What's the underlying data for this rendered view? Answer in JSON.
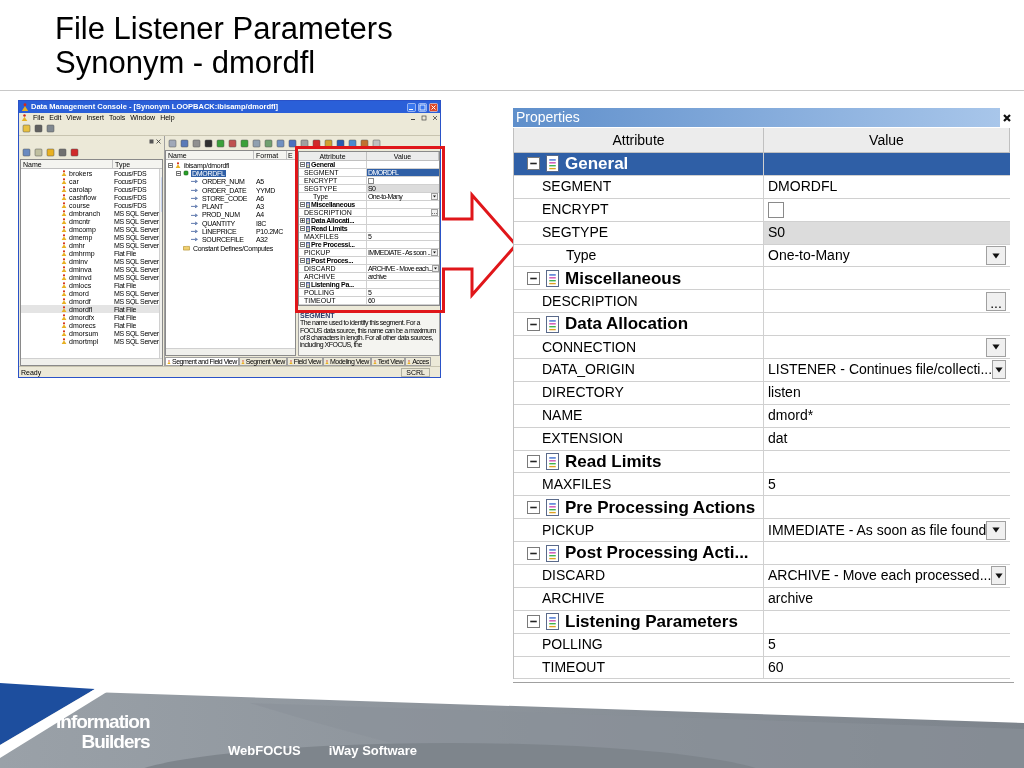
{
  "slide": {
    "title_lines": [
      "File Listener Parameters",
      "Synonym - dmordfl"
    ]
  },
  "console": {
    "window_title": "Data Management Console - [Synonym LOOPBACK:ibisamp/dmordfl]",
    "menu": [
      "File",
      "Edit",
      "View",
      "Insert",
      "Tools",
      "Window",
      "Help"
    ],
    "file_list": {
      "columns": [
        "Name",
        "Type"
      ],
      "rows": [
        {
          "name": "brokers",
          "type": "Focus/FDS",
          "selected": false
        },
        {
          "name": "car",
          "type": "Focus/FDS",
          "selected": false
        },
        {
          "name": "carolap",
          "type": "Focus/FDS",
          "selected": false
        },
        {
          "name": "cashflow",
          "type": "Focus/FDS",
          "selected": false
        },
        {
          "name": "course",
          "type": "Focus/FDS",
          "selected": false
        },
        {
          "name": "dmbranch",
          "type": "MS SQL Server",
          "selected": false
        },
        {
          "name": "dmcntr",
          "type": "MS SQL Server",
          "selected": false
        },
        {
          "name": "dmcomp",
          "type": "MS SQL Server",
          "selected": false
        },
        {
          "name": "dmemp",
          "type": "MS SQL Server",
          "selected": false
        },
        {
          "name": "dmhr",
          "type": "MS SQL Server",
          "selected": false
        },
        {
          "name": "dmhrmp",
          "type": "Flat File",
          "selected": false
        },
        {
          "name": "dminv",
          "type": "MS SQL Server",
          "selected": false
        },
        {
          "name": "dminva",
          "type": "MS SQL Server",
          "selected": false
        },
        {
          "name": "dminvd",
          "type": "MS SQL Server",
          "selected": false
        },
        {
          "name": "dmlocs",
          "type": "Flat File",
          "selected": false
        },
        {
          "name": "dmord",
          "type": "MS SQL Server",
          "selected": false
        },
        {
          "name": "dmordf",
          "type": "MS SQL Server",
          "selected": false
        },
        {
          "name": "dmordfl",
          "type": "Flat File",
          "selected": true
        },
        {
          "name": "dmordfx",
          "type": "Flat File",
          "selected": false
        },
        {
          "name": "dmorecs",
          "type": "Flat File",
          "selected": false
        },
        {
          "name": "dmorsum",
          "type": "MS SQL Server",
          "selected": false
        },
        {
          "name": "dmortmpl",
          "type": "MS SQL Server",
          "selected": false
        }
      ]
    },
    "tree": {
      "columns": [
        "Name",
        "Format",
        "E"
      ],
      "nodes": [
        {
          "kind": "synonym",
          "label": "ibisamp/dmordfl",
          "expanded": true,
          "selected": false,
          "children": [
            {
              "kind": "segment",
              "label": "DMORDFL",
              "expanded": true,
              "selected": true,
              "children": [
                {
                  "kind": "field",
                  "label": "ORDER_NUM",
                  "format": "A5",
                  "selected": false
                },
                {
                  "kind": "field",
                  "label": "ORDER_DATE",
                  "format": "YYMD",
                  "selected": false
                },
                {
                  "kind": "field",
                  "label": "STORE_CODE",
                  "format": "A6",
                  "selected": false
                },
                {
                  "kind": "field",
                  "label": "PLANT",
                  "format": "A3",
                  "selected": false
                },
                {
                  "kind": "field",
                  "label": "PROD_NUM",
                  "format": "A4",
                  "selected": false
                },
                {
                  "kind": "field",
                  "label": "QUANTITY",
                  "format": "I8C",
                  "selected": false
                },
                {
                  "kind": "field",
                  "label": "LINEPRICE",
                  "format": "P10.2MC",
                  "selected": false
                },
                {
                  "kind": "field",
                  "label": "SOURCEFILE",
                  "format": "A32",
                  "selected": false
                }
              ]
            },
            {
              "kind": "folder",
              "label": "Constant Defines/Computes",
              "selected": false
            }
          ]
        }
      ]
    },
    "properties": {
      "columns": [
        "Attribute",
        "Value"
      ],
      "rows": [
        {
          "kind": "section",
          "label": "General",
          "expanded": true,
          "selected": false,
          "children": [
            {
              "kind": "text",
              "label": "SEGMENT",
              "value": "DMORDFL",
              "selected": true,
              "readonly": false
            },
            {
              "kind": "checkbox",
              "label": "ENCRYPT",
              "checked": false,
              "selected": false,
              "readonly": false
            },
            {
              "kind": "text",
              "label": "SEGTYPE",
              "value": "S0",
              "selected": false,
              "readonly": true,
              "children": [
                {
                  "kind": "dropdown",
                  "label": "Type",
                  "value": "One-to-Many",
                  "selected": false,
                  "readonly": false
                }
              ]
            }
          ]
        },
        {
          "kind": "section",
          "label": "Miscellaneous",
          "expanded": true,
          "selected": false,
          "children": [
            {
              "kind": "ellipsis",
              "label": "DESCRIPTION",
              "button_label": "...",
              "selected": false,
              "readonly": false
            }
          ]
        },
        {
          "kind": "section",
          "label": "Data Allocati...",
          "expanded": false,
          "selected": false
        },
        {
          "kind": "section",
          "label": "Read Limits",
          "expanded": true,
          "selected": false,
          "children": [
            {
              "kind": "text",
              "label": "MAXFILES",
              "value": "5",
              "selected": false,
              "readonly": false
            }
          ]
        },
        {
          "kind": "section",
          "label": "Pre Processi...",
          "expanded": true,
          "selected": false,
          "children": [
            {
              "kind": "dropdown",
              "label": "PICKUP",
              "value": "IMMEDIATE - As soon ...",
              "selected": false,
              "readonly": false
            }
          ]
        },
        {
          "kind": "section",
          "label": "Post Proces...",
          "expanded": true,
          "selected": false,
          "children": [
            {
              "kind": "dropdown",
              "label": "DISCARD",
              "value": "ARCHIVE - Move each...",
              "selected": false,
              "readonly": false
            },
            {
              "kind": "text",
              "label": "ARCHIVE",
              "value": "archive",
              "selected": false,
              "readonly": false
            }
          ]
        },
        {
          "kind": "section",
          "label": "Listening Pa...",
          "expanded": true,
          "selected": false,
          "children": [
            {
              "kind": "text",
              "label": "POLLING",
              "value": "5",
              "selected": false,
              "readonly": false
            },
            {
              "kind": "text",
              "label": "TIMEOUT",
              "value": "60",
              "selected": false,
              "readonly": false
            }
          ]
        }
      ]
    },
    "description": {
      "heading": "SEGMENT",
      "text": "The name used to identify this segment. For a FOCUS data source, this name can be a maximum of 8 characters in length. For all other data sources, including XFOCUS, the"
    },
    "view_tabs": [
      {
        "label": "Segment and Field View",
        "selected": true
      },
      {
        "label": "Segment View",
        "selected": false
      },
      {
        "label": "Field View",
        "selected": false
      },
      {
        "label": "Modeling View",
        "selected": false
      },
      {
        "label": "Text View",
        "selected": false
      },
      {
        "label": "Acces",
        "selected": false
      }
    ],
    "status_bar": {
      "left": "Ready",
      "right": "SCRL"
    }
  },
  "properties_panel": {
    "title": "Properties",
    "columns": [
      "Attribute",
      "Value"
    ],
    "rows": [
      {
        "kind": "section",
        "label": "General",
        "expanded": true,
        "selected": true,
        "children": [
          {
            "kind": "text",
            "label": "SEGMENT",
            "value": "DMORDFL",
            "selected": false,
            "readonly": false
          },
          {
            "kind": "checkbox",
            "label": "ENCRYPT",
            "checked": false,
            "selected": false,
            "readonly": false
          },
          {
            "kind": "text",
            "label": "SEGTYPE",
            "value": "S0",
            "selected": false,
            "readonly": true,
            "children": [
              {
                "kind": "dropdown",
                "label": "Type",
                "value": "One-to-Many",
                "selected": false,
                "readonly": false
              }
            ]
          }
        ]
      },
      {
        "kind": "section",
        "label": "Miscellaneous",
        "expanded": true,
        "selected": false,
        "children": [
          {
            "kind": "ellipsis",
            "label": "DESCRIPTION",
            "button_label": "...",
            "selected": false,
            "readonly": false
          }
        ]
      },
      {
        "kind": "section",
        "label": "Data Allocation",
        "expanded": true,
        "selected": false,
        "children": [
          {
            "kind": "dropdown",
            "label": "CONNECTION",
            "selected": false,
            "readonly": false
          },
          {
            "kind": "dropdown",
            "label": "DATA_ORIGIN",
            "value": "LISTENER - Continues file/collecti...",
            "selected": false,
            "readonly": false
          },
          {
            "kind": "text",
            "label": "DIRECTORY",
            "value": "listen",
            "selected": false,
            "readonly": false
          },
          {
            "kind": "text",
            "label": "NAME",
            "value": "dmord*",
            "selected": false,
            "readonly": false
          },
          {
            "kind": "text",
            "label": "EXTENSION",
            "value": "dat",
            "selected": false,
            "readonly": false
          }
        ]
      },
      {
        "kind": "section",
        "label": "Read Limits",
        "expanded": true,
        "selected": false,
        "children": [
          {
            "kind": "text",
            "label": "MAXFILES",
            "value": "5",
            "selected": false,
            "readonly": false
          }
        ]
      },
      {
        "kind": "section",
        "label": "Pre Processing Actions",
        "expanded": true,
        "selected": false,
        "children": [
          {
            "kind": "dropdown",
            "label": "PICKUP",
            "value": "IMMEDIATE - As soon as file found",
            "selected": false,
            "readonly": false
          }
        ]
      },
      {
        "kind": "section",
        "label": "Post Processing Acti...",
        "expanded": true,
        "selected": false,
        "children": [
          {
            "kind": "dropdown",
            "label": "DISCARD",
            "value": "ARCHIVE - Move each processed...",
            "selected": false,
            "readonly": false
          },
          {
            "kind": "text",
            "label": "ARCHIVE",
            "value": "archive",
            "selected": false,
            "readonly": false
          }
        ]
      },
      {
        "kind": "section",
        "label": "Listening Parameters",
        "expanded": true,
        "selected": false,
        "children": [
          {
            "kind": "text",
            "label": "POLLING",
            "value": "5",
            "selected": false,
            "readonly": false
          },
          {
            "kind": "text",
            "label": "TIMEOUT",
            "value": "60",
            "selected": false,
            "readonly": false
          }
        ]
      }
    ]
  },
  "footer": {
    "logo_lines": [
      "Information",
      "Builders"
    ],
    "products": [
      "WebFOCUS",
      "iWay Software"
    ]
  }
}
